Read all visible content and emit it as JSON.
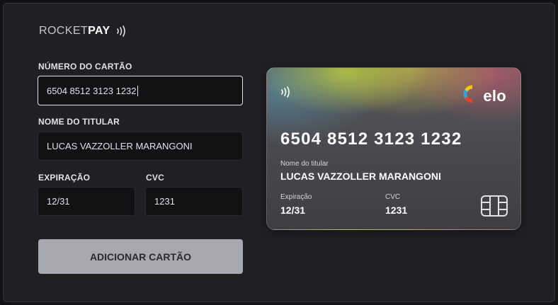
{
  "brand": {
    "rocket": "ROCKET",
    "pay": "PAY"
  },
  "form": {
    "card_number_label": "NÚMERO DO CARTÃO",
    "card_number_value": "6504 8512 3123 1232",
    "holder_label": "NOME DO TITULAR",
    "holder_value": "LUCAS VAZZOLLER MARANGONI",
    "expiry_label": "EXPIRAÇÃO",
    "expiry_value": "12/31",
    "cvc_label": "CVC",
    "cvc_value": "1231",
    "submit_label": "ADICIONAR CARTÃO"
  },
  "card_preview": {
    "network": "elo",
    "number": "6504 8512 3123 1232",
    "holder_label": "Nome do titular",
    "holder_name": "LUCAS VAZZOLLER MARANGONI",
    "expiry_label": "Expiração",
    "expiry": "12/31",
    "cvc_label": "CVC",
    "cvc": "1231"
  },
  "icons": [
    "contactless-icon",
    "elo-logo-icon",
    "chip-icon"
  ],
  "colors": {
    "background": "#121214",
    "panel": "#202024",
    "input_bg": "#121214",
    "button_bg": "#a8a8b3",
    "button_text": "#29292e",
    "text": "#e1e1e6"
  }
}
